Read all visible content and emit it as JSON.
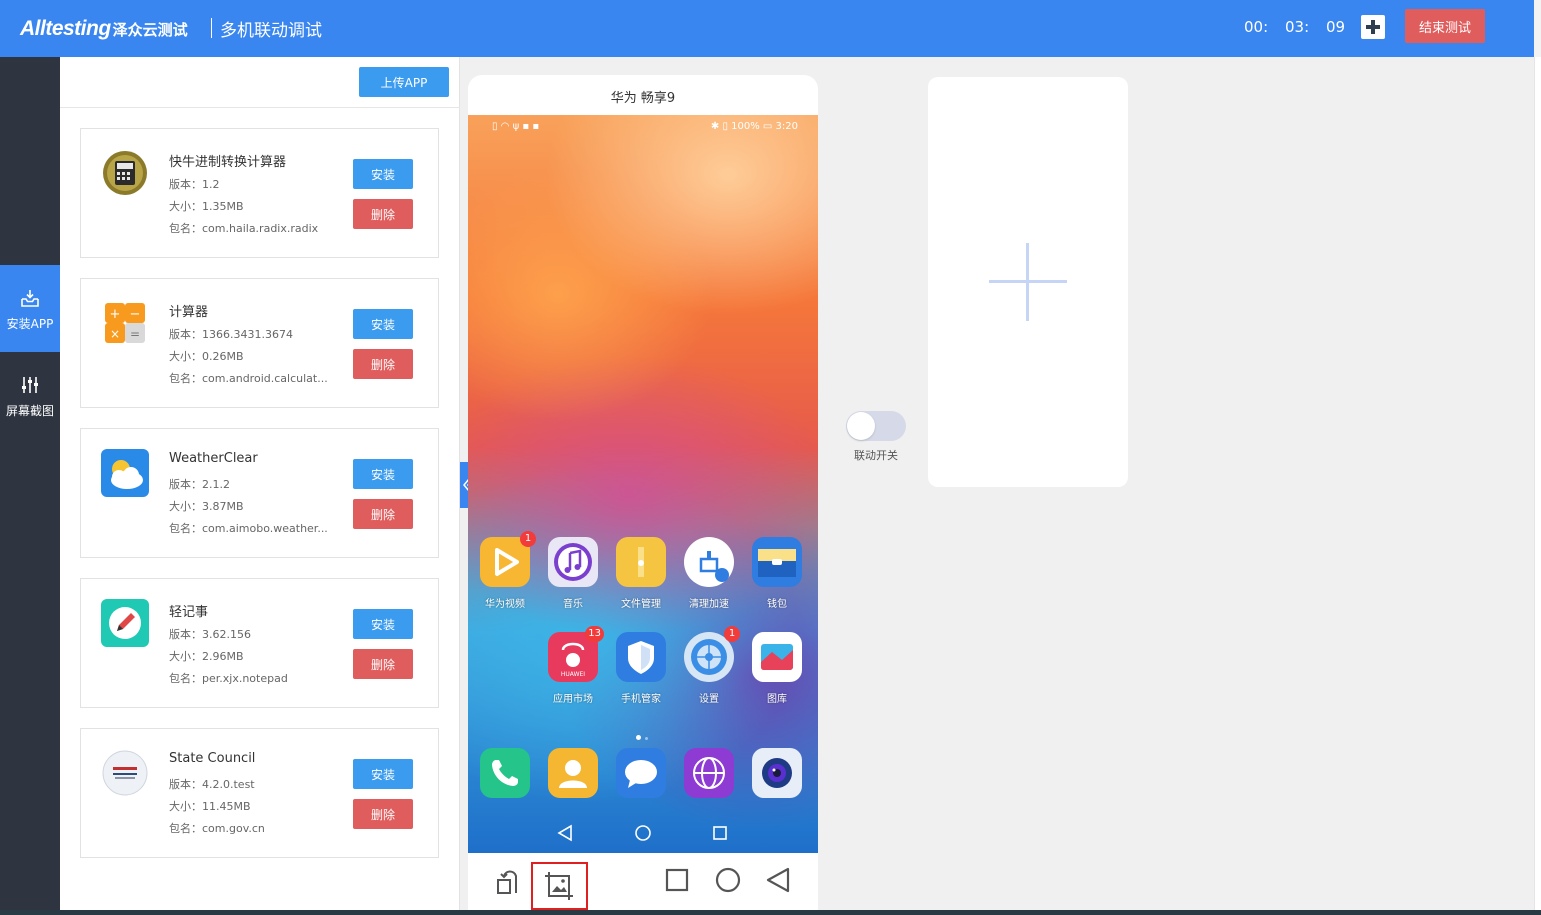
{
  "header": {
    "brand": "Alltesting",
    "brand_cn": "泽众云测试",
    "title": "多机联动调试",
    "timer": {
      "hours": "00:",
      "minutes": "03:",
      "seconds": "09"
    },
    "end_label": "结束测试"
  },
  "nav": {
    "items": [
      {
        "label": "安装APP",
        "icon": "download-tray-icon",
        "active": true
      },
      {
        "label": "屏幕截图",
        "icon": "sliders-icon",
        "active": false
      }
    ]
  },
  "panel": {
    "upload_label": "上传APP",
    "apps": [
      {
        "name": "快牛进制转换计算器",
        "version": "版本：1.2",
        "size": "大小：1.35MB",
        "package": "包名：com.haila.radix.radix",
        "icon": "radix-calculator-icon"
      },
      {
        "name": "计算器",
        "version": "版本：1366.3431.3674",
        "size": "大小：0.26MB",
        "package": "包名：com.android.calculat...",
        "icon": "calculator-icon"
      },
      {
        "name": "WeatherClear",
        "version": "版本：2.1.2",
        "size": "大小：3.87MB",
        "package": "包名：com.aimobo.weather...",
        "icon": "weather-cloud-icon"
      },
      {
        "name": "轻记事",
        "version": "版本：3.62.156",
        "size": "大小：2.96MB",
        "package": "包名：per.xjx.notepad",
        "icon": "notepad-pen-icon"
      },
      {
        "name": "State Council",
        "version": "版本：4.2.0.test",
        "size": "大小：11.45MB",
        "package": "包名：com.gov.cn",
        "icon": "state-council-icon"
      }
    ],
    "install_label": "安装",
    "delete_label": "删除"
  },
  "phone": {
    "name": "华为 畅享9",
    "status_left": "▯ ◠ ψ ▪ ▪",
    "status_right": "✱ ▯ 100% ▭ 3:20",
    "home_row1": [
      {
        "label": "华为视频",
        "icon": "huawei-video-icon",
        "badge": "1",
        "color": "#f7b733"
      },
      {
        "label": "音乐",
        "icon": "music-icon",
        "badge": "",
        "color": "#e9e6f5"
      },
      {
        "label": "文件管理",
        "icon": "file-manager-icon",
        "badge": "",
        "color": "#f5c542"
      },
      {
        "label": "清理加速",
        "icon": "cleaner-icon",
        "badge": "",
        "color": "#ffffff"
      },
      {
        "label": "钱包",
        "icon": "wallet-icon",
        "badge": "",
        "color": "#2f7de1"
      }
    ],
    "home_row2": [
      {
        "label": "应用市场",
        "icon": "app-market-icon",
        "badge": "13",
        "color": "#e83a5d"
      },
      {
        "label": "手机管家",
        "icon": "phone-manager-icon",
        "badge": "",
        "color": "#2f7de1"
      },
      {
        "label": "设置",
        "icon": "settings-icon",
        "badge": "1",
        "color": "#d6e6f5"
      },
      {
        "label": "图库",
        "icon": "gallery-icon",
        "badge": "",
        "color": "#ffffff"
      }
    ],
    "dock": [
      {
        "icon": "phone-call-icon",
        "color": "#24c48a"
      },
      {
        "icon": "contacts-icon",
        "color": "#f5b731"
      },
      {
        "icon": "messages-icon",
        "color": "#2f7de1"
      },
      {
        "icon": "browser-icon",
        "color": "#8e3bd4"
      },
      {
        "icon": "camera-icon",
        "color": "#e8eef8"
      }
    ]
  },
  "link_toggle": {
    "label": "联动开关",
    "on": false
  },
  "colors": {
    "primary": "#3a86f0",
    "danger": "#e05d5d",
    "nav_bg": "#2e3440"
  }
}
